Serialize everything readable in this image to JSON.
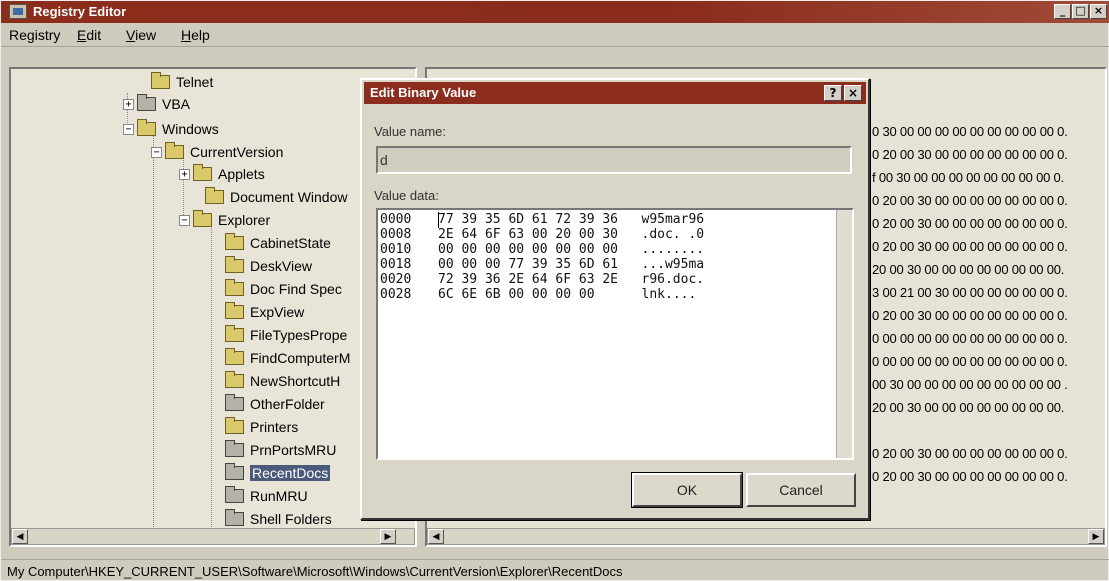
{
  "window": {
    "title": "Registry Editor",
    "buttons": {
      "minimize": "_",
      "maximize": "□",
      "close": "×"
    }
  },
  "menu": [
    {
      "label": "Registry",
      "access_key": "g"
    },
    {
      "label": "Edit",
      "access_key": "E"
    },
    {
      "label": "View",
      "access_key": "V"
    },
    {
      "label": "Help",
      "access_key": "H"
    }
  ],
  "tree": {
    "items": [
      {
        "label": "Telnet",
        "expander": ""
      },
      {
        "label": "VBA",
        "expander": "+"
      },
      {
        "label": "Windows",
        "expander": "−"
      },
      {
        "label": "CurrentVersion",
        "expander": "−"
      },
      {
        "label": "Applets",
        "expander": "+"
      },
      {
        "label": "Document Window",
        "expander": ""
      },
      {
        "label": "Explorer",
        "expander": "−"
      },
      {
        "label": "CabinetState",
        "expander": ""
      },
      {
        "label": "DeskView",
        "expander": ""
      },
      {
        "label": "Doc Find Spec",
        "expander": ""
      },
      {
        "label": "ExpView",
        "expander": ""
      },
      {
        "label": "FileTypesPrope",
        "expander": ""
      },
      {
        "label": "FindComputerM",
        "expander": ""
      },
      {
        "label": "NewShortcutH",
        "expander": ""
      },
      {
        "label": "OtherFolder",
        "expander": ""
      },
      {
        "label": "Printers",
        "expander": ""
      },
      {
        "label": "PrnPortsMRU",
        "expander": ""
      },
      {
        "label": "RecentDocs",
        "expander": "",
        "selected": true
      },
      {
        "label": "RunMRU",
        "expander": ""
      },
      {
        "label": "Shell Folders",
        "expander": ""
      }
    ]
  },
  "data_rows": [
    "0 30 00 00 00 00 00 00 00 00 00 0.",
    "0 20 00 30 00 00 00 00 00 00 00 0.",
    "f 00 30 00 00 00 00 00 00 00 00 0.",
    "0 20 00 30 00 00 00 00 00 00 00 0.",
    "0 20 00 30 00 00 00 00 00 00 00 0.",
    "0 20 00 30 00 00 00 00 00 00 00 0.",
    "20 00 30 00 00 00 00 00 00 00 00.",
    "3 00 21 00 30 00 00 00 00 00 00 0.",
    "0 20 00 30 00 00 00 00 00 00 00 0.",
    "0 00 00 00 00 00 00 00 00 00 00 0.",
    "0 00 00 00 00 00 00 00 00 00 00 0.",
    "00 30 00 00 00 00 00 00 00 00 00 .",
    "20 00 30 00 00 00 00 00 00 00 00.",
    "",
    "0 20 00 30 00 00 00 00 00 00 00 0.",
    "0 20 00 30 00 00 00 00 00 00 00 0."
  ],
  "status_path": "My Computer\\HKEY_CURRENT_USER\\Software\\Microsoft\\Windows\\CurrentVersion\\Explorer\\RecentDocs",
  "dialog": {
    "title": "Edit Binary Value",
    "help_button": "?",
    "close_button": "×",
    "value_name_label": "Value name:",
    "value_name": "d",
    "value_data_label": "Value data:",
    "value_data": [
      {
        "addr": "0000",
        "hex": "77 39 35 6D 61 72 39 36",
        "ascii": "w95mar96"
      },
      {
        "addr": "0008",
        "hex": "2E 64 6F 63 00 20 00 30",
        "ascii": ".doc. .0"
      },
      {
        "addr": "0010",
        "hex": "00 00 00 00 00 00 00 00",
        "ascii": "........"
      },
      {
        "addr": "0018",
        "hex": "00 00 00 77 39 35 6D 61",
        "ascii": "...w95ma"
      },
      {
        "addr": "0020",
        "hex": "72 39 36 2E 64 6F 63 2E",
        "ascii": "r96.doc."
      },
      {
        "addr": "0028",
        "hex": "6C 6E 6B 00 00 00 00",
        "ascii": "lnk...."
      }
    ],
    "ok_label": "OK",
    "cancel_label": "Cancel"
  }
}
